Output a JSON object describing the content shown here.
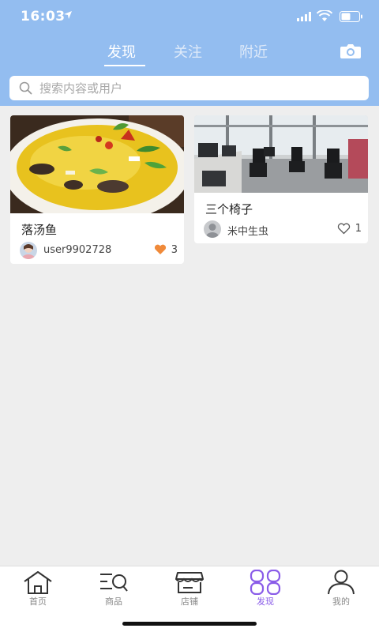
{
  "status_bar": {
    "time": "16:03"
  },
  "header": {
    "tabs": [
      {
        "label": "发现",
        "active": true
      },
      {
        "label": "关注",
        "active": false
      },
      {
        "label": "附近",
        "active": false
      }
    ],
    "camera_icon": "camera-icon"
  },
  "search": {
    "placeholder": "搜索内容或用户",
    "value": ""
  },
  "feed": [
    {
      "title": "落汤鱼",
      "user": "user9902728",
      "likes": "3",
      "liked": true
    },
    {
      "title": "三个椅子",
      "user": "米中生虫",
      "likes": "1",
      "liked": false
    }
  ],
  "bottom_nav": [
    {
      "label": "首页",
      "icon": "home-icon",
      "active": false
    },
    {
      "label": "商品",
      "icon": "products-icon",
      "active": false
    },
    {
      "label": "店铺",
      "icon": "store-icon",
      "active": false
    },
    {
      "label": "发现",
      "icon": "discover-icon",
      "active": true
    },
    {
      "label": "我的",
      "icon": "profile-icon",
      "active": false
    }
  ],
  "colors": {
    "header_bg": "#93bdf0",
    "accent": "#8a5ce8",
    "like_filled": "#f08a3a",
    "page_bg": "#eeeeee"
  }
}
